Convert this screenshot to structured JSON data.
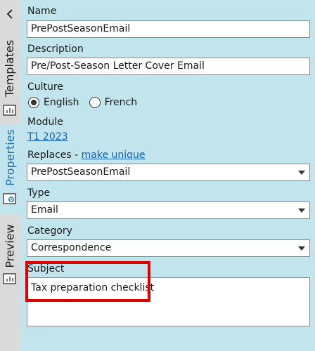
{
  "rail": {
    "tabs": [
      {
        "label": "Templates",
        "icon": "chart-icon"
      },
      {
        "label": "Properties",
        "icon": "gear-icon",
        "active": true
      },
      {
        "label": "Preview",
        "icon": "chart-icon"
      }
    ]
  },
  "form": {
    "name_label": "Name",
    "name_value": "PrePostSeasonEmail",
    "description_label": "Description",
    "description_value": "Pre/Post-Season Letter Cover Email",
    "culture_label": "Culture",
    "culture_options": [
      {
        "label": "English",
        "selected": true
      },
      {
        "label": "French",
        "selected": false
      }
    ],
    "module_label": "Module",
    "module_value": "T1 2023",
    "replaces_label": "Replaces - ",
    "replaces_link": "make unique",
    "replaces_value": "PrePostSeasonEmail",
    "type_label": "Type",
    "type_value": "Email",
    "category_label": "Category",
    "category_value": "Correspondence",
    "subject_label": "Subject",
    "subject_value": "Tax preparation checklist"
  },
  "colors": {
    "panel_bg": "#c2e4ec",
    "rail_bg": "#dadada",
    "link": "#1060b8",
    "highlight": "#e00000"
  }
}
